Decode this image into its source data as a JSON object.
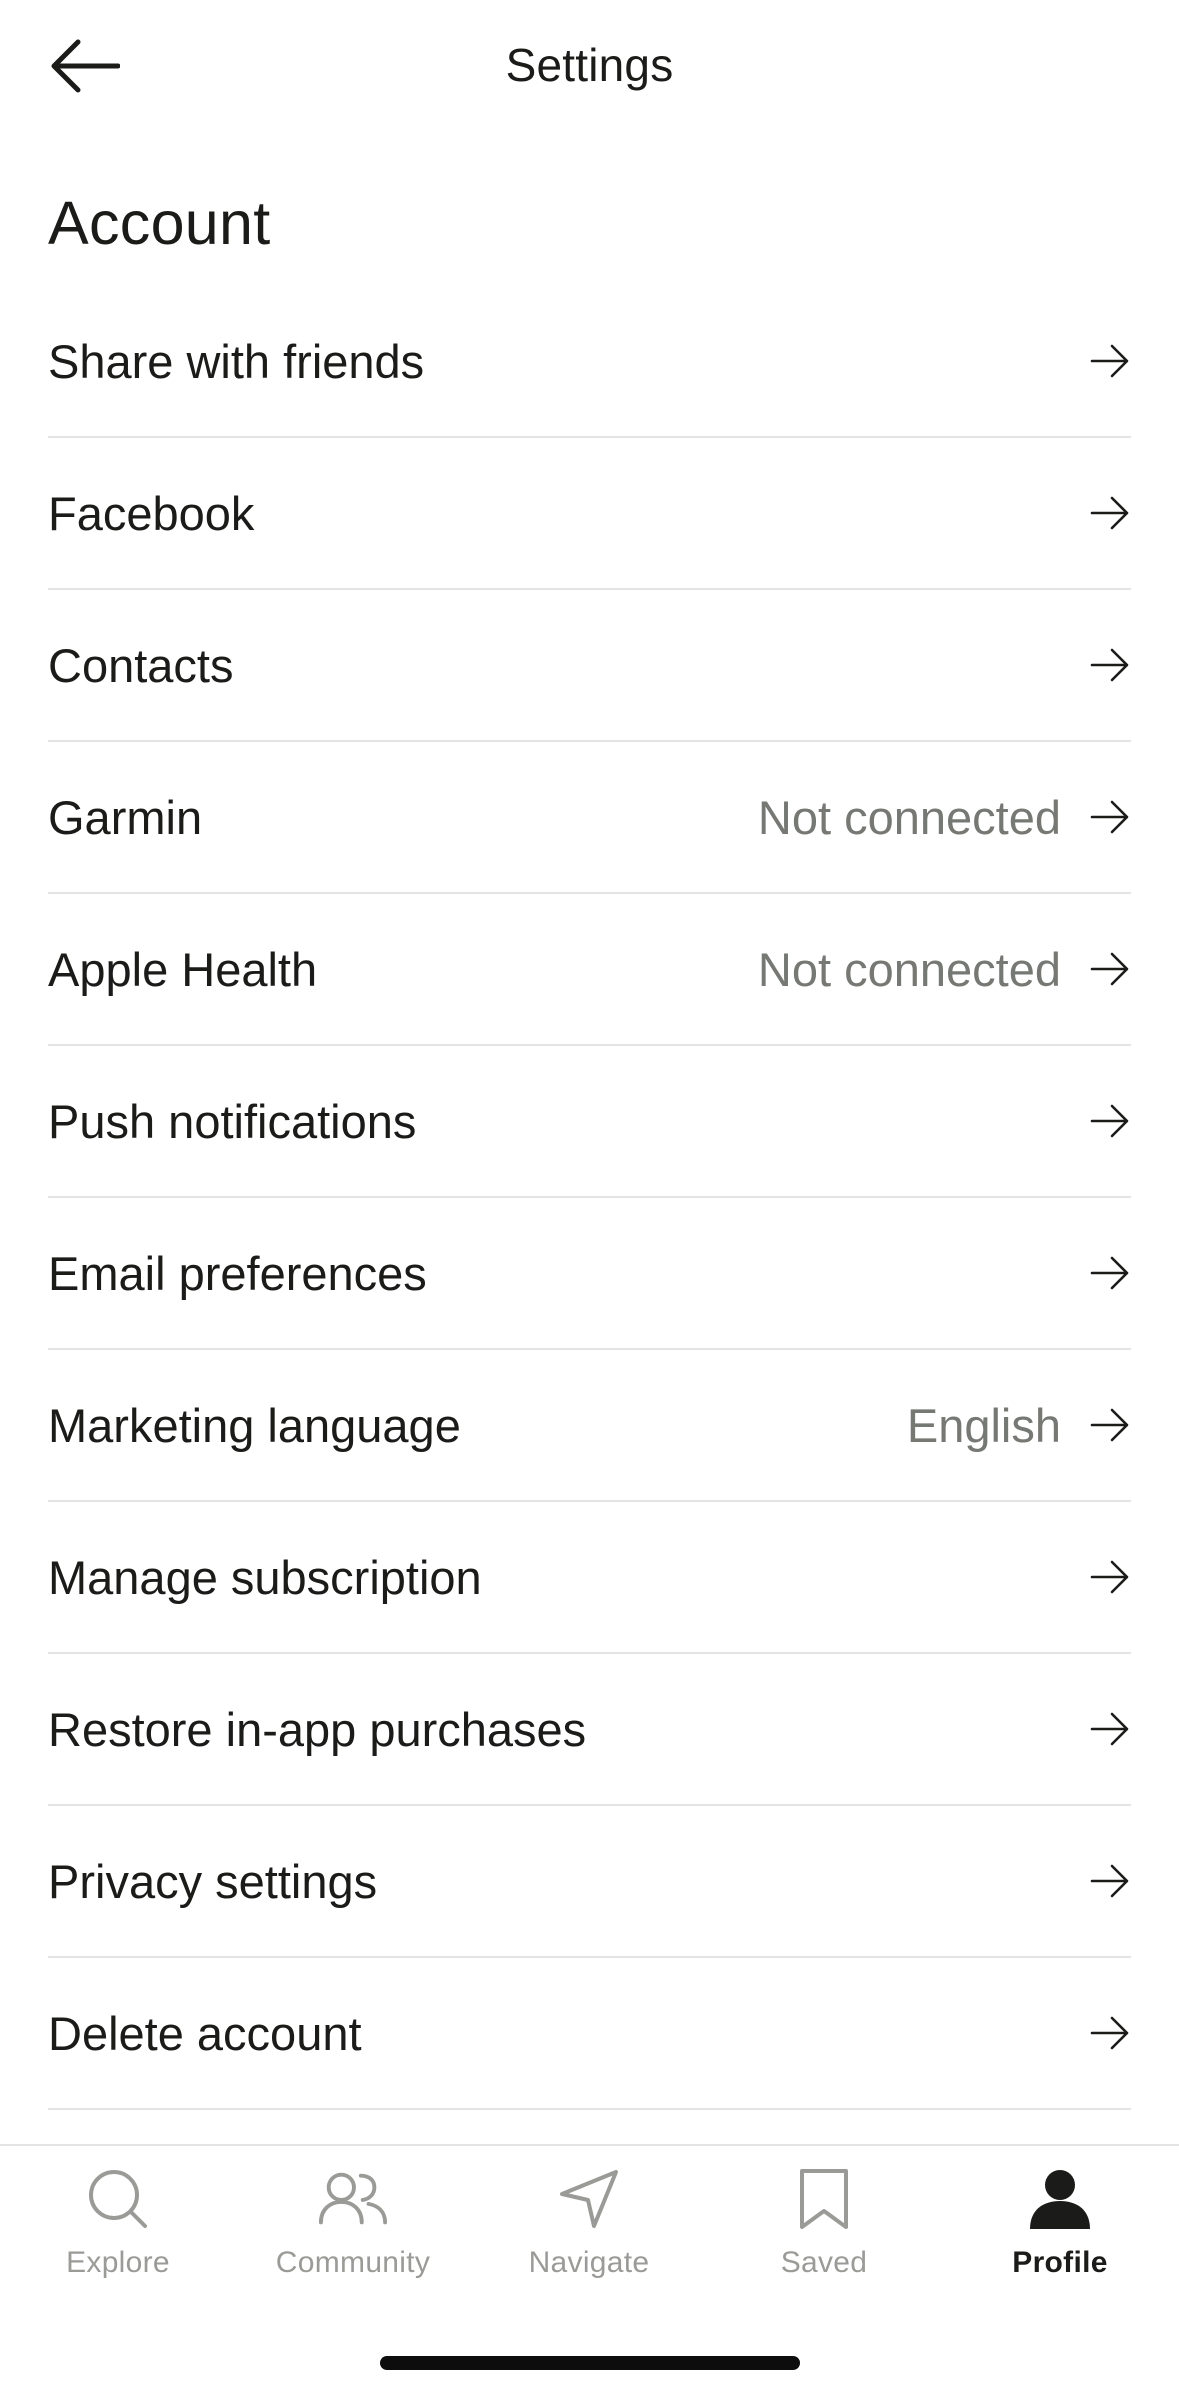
{
  "header": {
    "title": "Settings",
    "back_icon": "arrow-left-icon"
  },
  "section": {
    "title": "Account"
  },
  "rows": [
    {
      "label": "Share with friends",
      "value": ""
    },
    {
      "label": "Facebook",
      "value": ""
    },
    {
      "label": "Contacts",
      "value": ""
    },
    {
      "label": "Garmin",
      "value": "Not connected"
    },
    {
      "label": "Apple Health",
      "value": "Not connected"
    },
    {
      "label": "Push notifications",
      "value": ""
    },
    {
      "label": "Email preferences",
      "value": ""
    },
    {
      "label": "Marketing language",
      "value": "English"
    },
    {
      "label": "Manage subscription",
      "value": ""
    },
    {
      "label": "Restore in-app purchases",
      "value": ""
    },
    {
      "label": "Privacy settings",
      "value": ""
    },
    {
      "label": "Delete account",
      "value": ""
    }
  ],
  "tabs": [
    {
      "label": "Explore",
      "icon": "search-icon",
      "active": false
    },
    {
      "label": "Community",
      "icon": "people-icon",
      "active": false
    },
    {
      "label": "Navigate",
      "icon": "navigation-arrow-icon",
      "active": false
    },
    {
      "label": "Saved",
      "icon": "bookmark-icon",
      "active": false
    },
    {
      "label": "Profile",
      "icon": "person-icon",
      "active": true
    }
  ],
  "colors": {
    "text": "#1b1c19",
    "secondary_text": "#767873",
    "inactive_tab": "#9a9b97",
    "divider": "#e4e4e2"
  }
}
